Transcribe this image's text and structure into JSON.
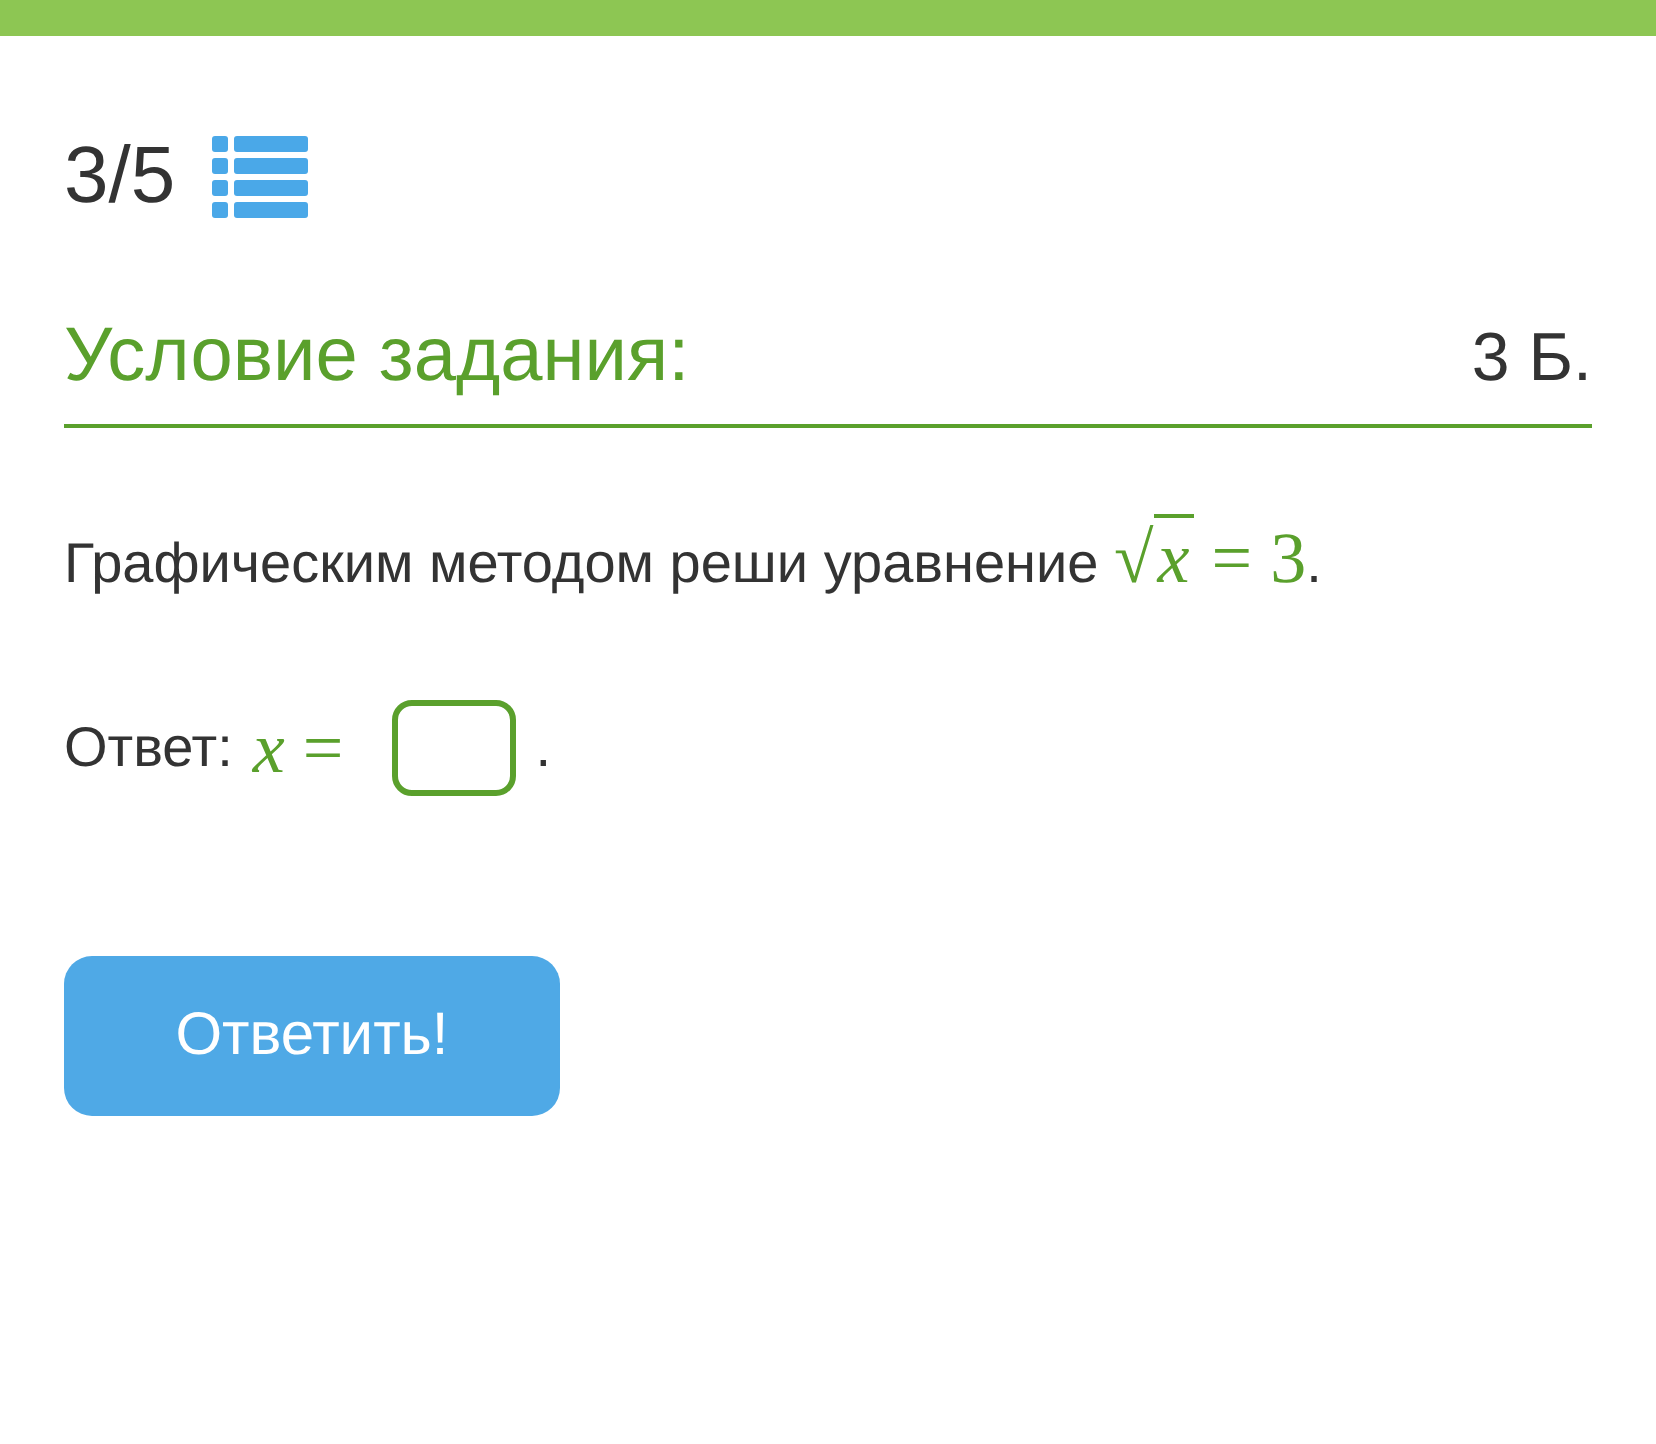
{
  "progress": {
    "counter": "3/5"
  },
  "task": {
    "heading": "Условие задания:",
    "points": "3 Б."
  },
  "question": {
    "text": "Графическим методом реши уравнение",
    "radical": "√",
    "radicand": "x",
    "equals": "=",
    "value": "3",
    "end": "."
  },
  "answer": {
    "label": "Ответ:",
    "variable": "x",
    "equals": "=",
    "end": "."
  },
  "submit": {
    "label": "Ответить!"
  }
}
